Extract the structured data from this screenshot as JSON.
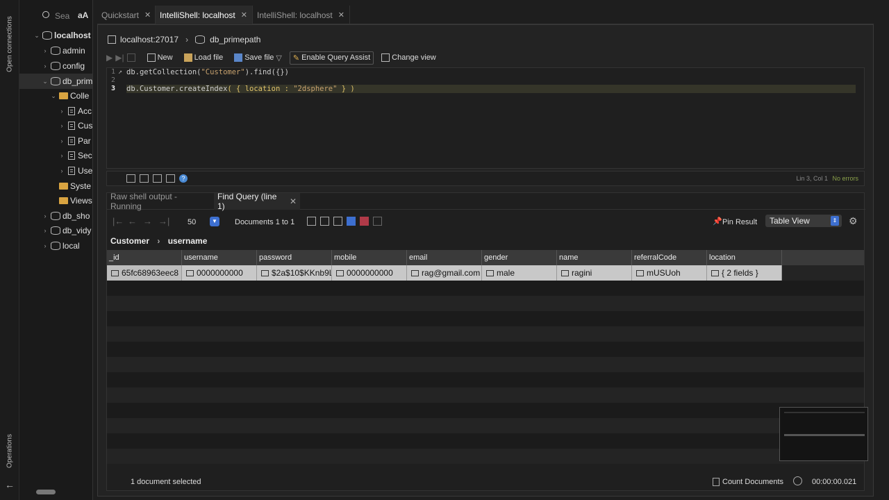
{
  "vertical_bar": {
    "open_connections": "Open connections",
    "operations": "Operations"
  },
  "sidebar": {
    "search_placeholder": "Sea",
    "case_toggle": "aA",
    "tree": [
      {
        "label": "localhost",
        "kind": "server",
        "expanded": true,
        "level": 0
      },
      {
        "label": "admin",
        "kind": "db",
        "level": 1
      },
      {
        "label": "config",
        "kind": "db",
        "level": 1
      },
      {
        "label": "db_prim",
        "kind": "db",
        "level": 1,
        "expanded": true,
        "selected": true
      },
      {
        "label": "Colle",
        "kind": "folder",
        "level": 2,
        "expanded": true
      },
      {
        "label": "Acc",
        "kind": "coll",
        "level": 3
      },
      {
        "label": "Cus",
        "kind": "coll",
        "level": 3
      },
      {
        "label": "Par",
        "kind": "coll",
        "level": 3
      },
      {
        "label": "Sec",
        "kind": "coll",
        "level": 3
      },
      {
        "label": "Use",
        "kind": "coll",
        "level": 3
      },
      {
        "label": "Syste",
        "kind": "folder",
        "level": 2
      },
      {
        "label": "Views",
        "kind": "folder",
        "level": 2
      },
      {
        "label": "db_sho",
        "kind": "db",
        "level": 1
      },
      {
        "label": "db_vidy",
        "kind": "db",
        "level": 1
      },
      {
        "label": "local",
        "kind": "db",
        "level": 1
      }
    ]
  },
  "tabs": [
    {
      "label": "Quickstart",
      "active": false
    },
    {
      "label": "IntelliShell: localhost",
      "active": true
    },
    {
      "label": "IntelliShell: localhost",
      "active": false
    }
  ],
  "breadcrumb": {
    "host": "localhost:27017",
    "db": "db_primepath"
  },
  "toolbar": {
    "new": "New",
    "load": "Load file",
    "save": "Save file",
    "assist": "Enable Query Assist",
    "change_view": "Change view"
  },
  "editor": {
    "line_numbers": [
      "1",
      "2",
      "3"
    ],
    "line1_a": "db.getCollection(",
    "line1_str": "\"Customer\"",
    "line1_b": ").find({})",
    "line3_a": "db.Customer.createIndex",
    "line3_b": "( { location : ",
    "line3_str": "\"2dsphere\"",
    "line3_c": " } )",
    "position": "Lin 3, Col 1",
    "errors": "No errors"
  },
  "results": {
    "tabs": [
      "Raw shell output - Running",
      "Find Query (line 1)"
    ],
    "page_size": "50",
    "documents": "Documents 1 to 1",
    "pin": "Pin Result",
    "view": "Table View",
    "path_root": "Customer",
    "path_field": "username",
    "columns": [
      "_id",
      "username",
      "password",
      "mobile",
      "email",
      "gender",
      "name",
      "referralCode",
      "location"
    ],
    "rows": [
      [
        "65fc68963eec8",
        "0000000000",
        "$2a$10$KKnb9L",
        "0000000000",
        "rag@gmail.com",
        "male",
        "ragini",
        "mUSUoh",
        "{ 2 fields }"
      ]
    ],
    "selected_status": "1 document selected",
    "count_docs": "Count Documents",
    "elapsed": "00:00:00.021"
  }
}
